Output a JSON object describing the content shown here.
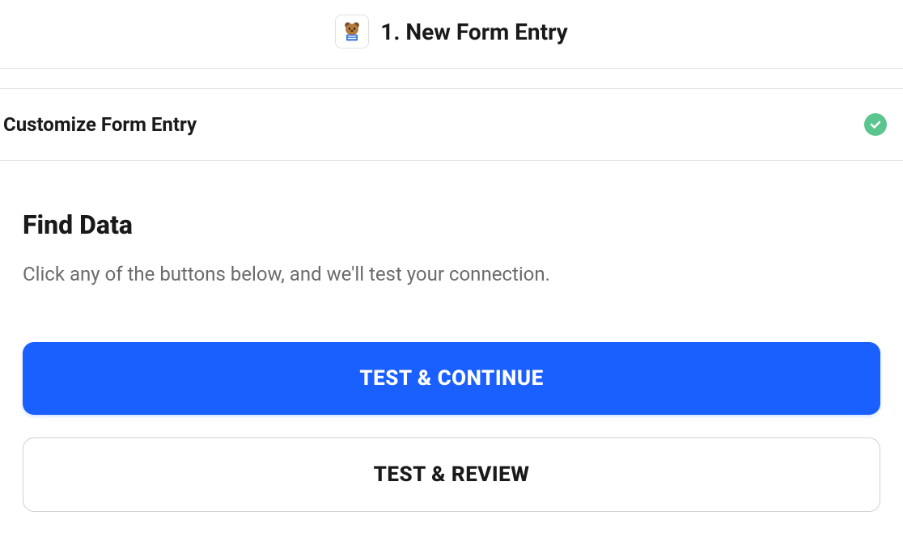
{
  "header": {
    "title": "1. New Form Entry",
    "icon": "wpforms-bear-icon"
  },
  "section": {
    "title": "Customize Form Entry",
    "status": "complete"
  },
  "content": {
    "heading": "Find Data",
    "description": "Click any of the buttons below, and we'll test your connection."
  },
  "buttons": {
    "primary": "TEST & CONTINUE",
    "secondary": "TEST & REVIEW"
  },
  "colors": {
    "primary": "#1a5fff",
    "success": "#5ac58d"
  }
}
